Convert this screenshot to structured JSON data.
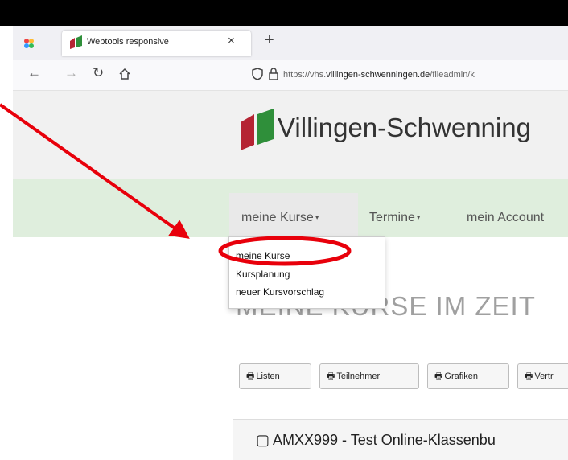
{
  "browser": {
    "tab_title": "Webtools responsive",
    "tab_close": "×",
    "new_tab": "+",
    "url_prefix": "https://vhs.",
    "url_domain": "villingen-schwenningen.de",
    "url_path": "/fileadmin/k"
  },
  "header": {
    "brand": "Villingen-Schwenning"
  },
  "menu": {
    "items": [
      {
        "label": "meine Kurse"
      },
      {
        "label": "Termine"
      },
      {
        "label": "mein Account"
      }
    ],
    "caret": "▾",
    "dropdown": [
      {
        "label": "meine Kurse"
      },
      {
        "label": "Kursplanung"
      },
      {
        "label": "neuer Kursvorschlag"
      }
    ]
  },
  "page": {
    "heading": "MEINE KURSE IM ZEIT"
  },
  "toolbar": {
    "buttons": [
      {
        "label": "Listen"
      },
      {
        "label": "Teilnehmer"
      },
      {
        "label": "Grafiken"
      },
      {
        "label": "Vertr"
      }
    ]
  },
  "course": {
    "title": "▢ AMXX999 - Test Online-Klassenbu"
  },
  "colors": {
    "menubar": "#dfeedd",
    "annotation": "#e8000b",
    "logo_red": "#b52433",
    "logo_green": "#2f8f3a"
  }
}
